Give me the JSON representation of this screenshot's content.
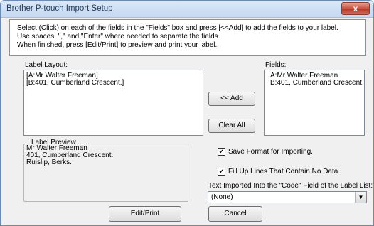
{
  "window": {
    "title": "Brother P-touch Import Setup",
    "close_glyph": "x"
  },
  "instructions": [
    "Select (Click) on each of the fields in the \"Fields\" box and press [<<Add] to add the fields to your label.",
    "Use spaces, \",\" and \"Enter\" where needed to separate the fields.",
    "When finished, press [Edit/Print] to preview and print your label."
  ],
  "label_layout": {
    "label": "Label Layout:",
    "lines": [
      "[A:Mr Walter Freeman]",
      "[B:401, Cumberland Crescent.]"
    ]
  },
  "fields": {
    "label": "Fields:",
    "items": [
      "A:Mr Walter Freeman",
      "B:401, Cumberland Crescent."
    ]
  },
  "buttons": {
    "add": "<< Add",
    "clear_all": "Clear All",
    "edit_print": "Edit/Print",
    "cancel": "Cancel"
  },
  "preview": {
    "legend": "Label Preview",
    "lines": [
      "Mr Walter Freeman",
      "401, Cumberland Crescent.",
      "Ruislip, Berks."
    ]
  },
  "options": {
    "save_format": {
      "label": "Save Format for Importing.",
      "checked": true,
      "mark": "✔"
    },
    "fill_up": {
      "label": "Fill Up Lines That Contain No Data.",
      "checked": true,
      "mark": "✔"
    }
  },
  "code_field": {
    "label": "Text Imported Into the \"Code\" Field of the Label List:",
    "selected": "(None)",
    "arrow_icon": "▼"
  }
}
